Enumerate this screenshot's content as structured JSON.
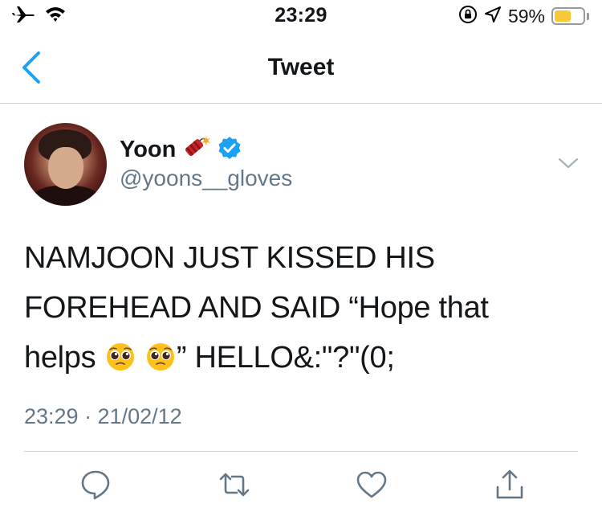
{
  "status_bar": {
    "time": "23:29",
    "battery_percent_label": "59%",
    "battery_level": 0.59,
    "icons": [
      "airplane-icon",
      "wifi-icon",
      "orientation-lock-icon",
      "location-icon",
      "battery-icon"
    ]
  },
  "nav": {
    "title": "Tweet",
    "back_icon": "chevron-left-icon"
  },
  "tweet": {
    "author": {
      "display_name": "Yoon",
      "name_emoji": "firecracker-icon",
      "verified": true,
      "handle": "@yoons__gloves"
    },
    "text_line1": "NAMJOON JUST KISSED HIS",
    "text_line2": "FOREHEAD AND SAID “Hope that",
    "text_line3_a": "helps",
    "text_line3_emojis": [
      "pleading-face-icon",
      "pleading-face-icon"
    ],
    "text_line3_b": "” HELLO&:\"?\"(0;",
    "timestamp": "23:29 · 21/02/12"
  },
  "actions": [
    {
      "name": "reply-icon"
    },
    {
      "name": "retweet-icon"
    },
    {
      "name": "like-icon"
    },
    {
      "name": "share-icon"
    }
  ],
  "colors": {
    "accent": "#1da1f2",
    "secondary_text": "#657786",
    "divider": "#cfd4d8",
    "battery": "#f6c935"
  }
}
